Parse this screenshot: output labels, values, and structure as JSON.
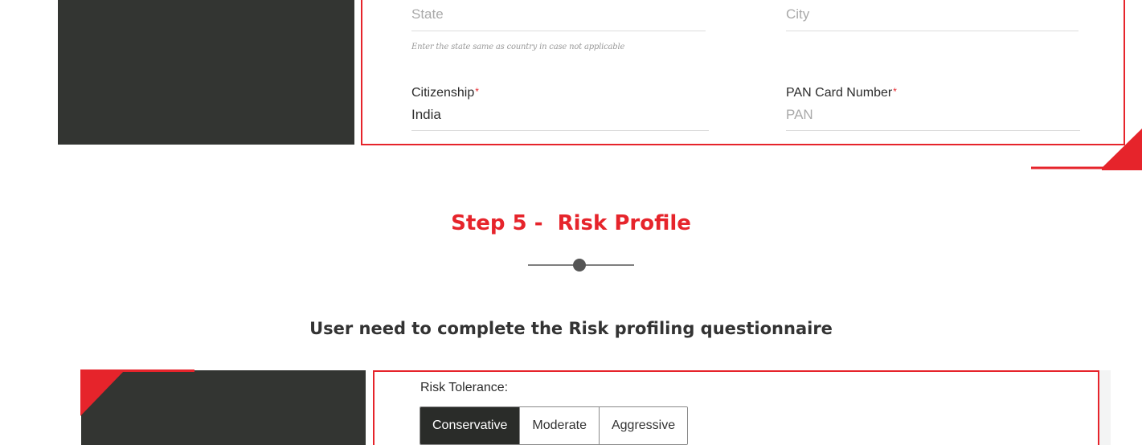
{
  "personal_details": {
    "state": {
      "placeholder": "State",
      "hint": "Enter the state same as country in case not applicable"
    },
    "city": {
      "placeholder": "City"
    },
    "citizenship": {
      "label": "Citizenship",
      "required_mark": "*",
      "value": "India"
    },
    "pan": {
      "label": "PAN Card Number",
      "required_mark": "*",
      "placeholder": "PAN"
    }
  },
  "step": {
    "heading": "Step 5 -  Risk Profile",
    "subheading": "User need to complete the Risk profiling questionnaire"
  },
  "risk_profile": {
    "label": "Risk Tolerance:",
    "options": [
      "Conservative",
      "Moderate",
      "Aggressive"
    ],
    "selected": "Conservative"
  },
  "colors": {
    "accent_red": "#e6242b",
    "dark_panel": "#333532",
    "selected_segment": "#2a2c29"
  }
}
